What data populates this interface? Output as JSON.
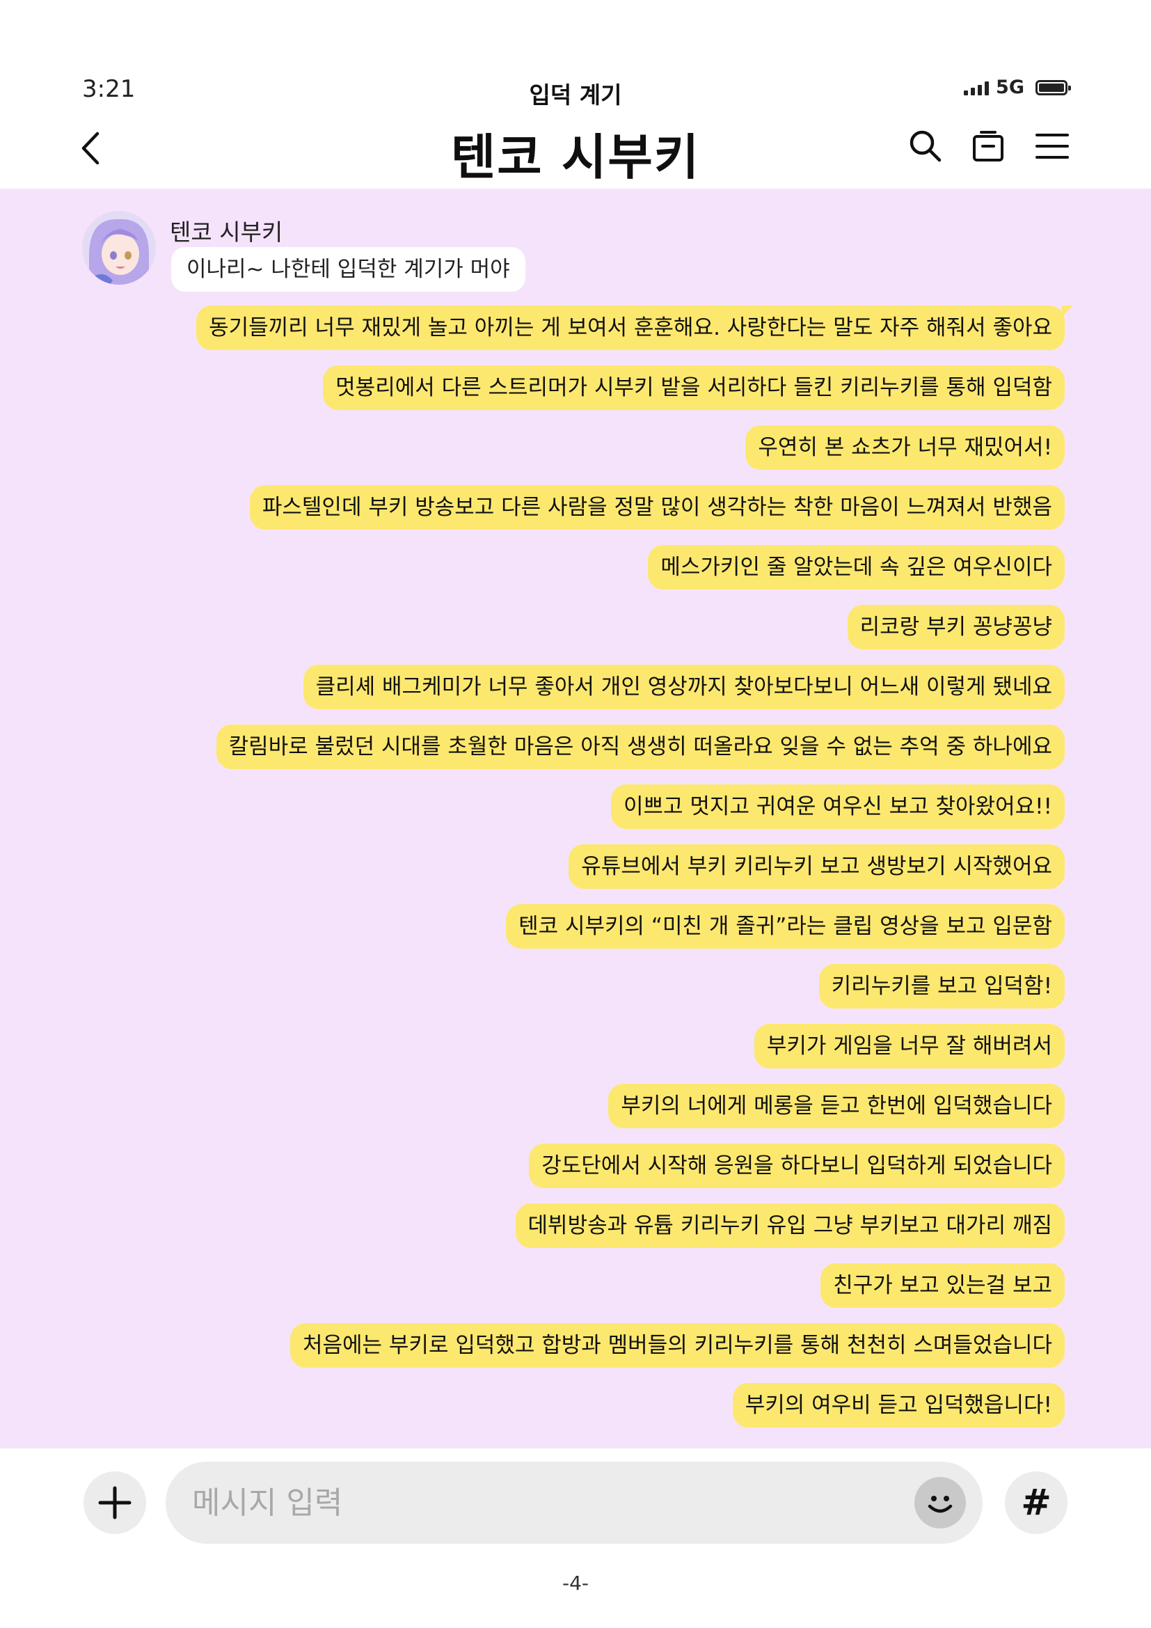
{
  "status_bar": {
    "time": "3:21",
    "subtitle": "입덕 계기",
    "network": "5G"
  },
  "header": {
    "title": "텐코 시부키",
    "icons": [
      "back-icon",
      "search-icon",
      "calendar-icon",
      "menu-icon"
    ]
  },
  "chat": {
    "background_color": "#f5e3fb",
    "outgoing_color": "#fde86f",
    "incoming": {
      "sender": "텐코 시부키",
      "text": "이나리~ 나한테 입덕한 계기가 머야"
    },
    "outgoing": [
      "동기들끼리 너무 재밌게 놀고 아끼는 게 보여서 훈훈해요. 사랑한다는 말도 자주 해줘서 좋아요",
      "멋봉리에서 다른 스트리머가 시부키 밭을 서리하다 들킨 키리누키를 통해 입덕함",
      "우연히 본 쇼츠가 너무 재밌어서!",
      "파스텔인데 부키 방송보고 다른 사람을 정말 많이 생각하는 착한 마음이 느껴져서 반했음",
      "메스가키인 줄 알았는데 속 깊은 여우신이다",
      "리코랑 부키 꽁냥꽁냥",
      "클리셰 배그케미가 너무 좋아서 개인 영상까지 찾아보다보니 어느새 이렇게 됐네요",
      "칼림바로 불렀던 시대를 초월한 마음은 아직 생생히 떠올라요 잊을 수 없는 추억 중 하나에요",
      "이쁘고 멋지고 귀여운 여우신 보고 찾아왔어요!!",
      "유튜브에서 부키 키리누키 보고 생방보기 시작했어요",
      "텐코 시부키의 “미친 개 졸귀”라는 클립 영상을 보고 입문함",
      "키리누키를 보고 입덕함!",
      "부키가 게임을 너무 잘 해버려서",
      "부키의 너에게 메롱을 듣고 한번에 입덕했습니다",
      "강도단에서 시작해 응원을 하다보니 입덕하게 되었습니다",
      "데뷔방송과 유튭 키리누키 유입 그냥 부키보고 대가리 깨짐",
      "친구가 보고 있는걸 보고",
      "처음에는 부키로 입덕했고 합방과 멤버들의 키리누키를 통해 천천히 스며들었습니다",
      "부키의 여우비 듣고 입덕했읍니다!"
    ]
  },
  "input_bar": {
    "placeholder": "메시지 입력",
    "hash_label": "#",
    "icons": [
      "plus-icon",
      "emoji-icon",
      "hash-icon"
    ]
  },
  "page_number": "-4-"
}
